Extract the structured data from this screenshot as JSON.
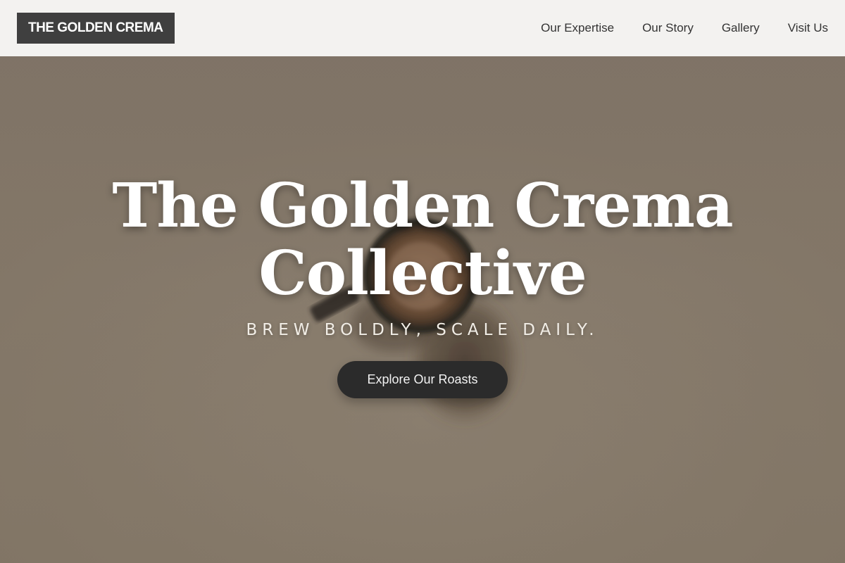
{
  "header": {
    "logo_text": "THE GOLDEN CREMA",
    "nav": [
      {
        "label": "Our Expertise"
      },
      {
        "label": "Our Story"
      },
      {
        "label": "Gallery"
      },
      {
        "label": "Visit Us"
      }
    ]
  },
  "hero": {
    "title_line1": "The Golden Crema",
    "title_line2": "Collective",
    "tagline": "BREW BOLDLY, SCALE DAILY.",
    "cta_label": "Explore Our Roasts",
    "background_image": "coffee-cup-photo"
  },
  "colors": {
    "header_bg": "#f3f2f0",
    "logo_bg": "#3f3f3f",
    "hero_bg": "#8b7e6f",
    "cta_bg": "#2b2b2b",
    "title_text": "#ffffff"
  }
}
